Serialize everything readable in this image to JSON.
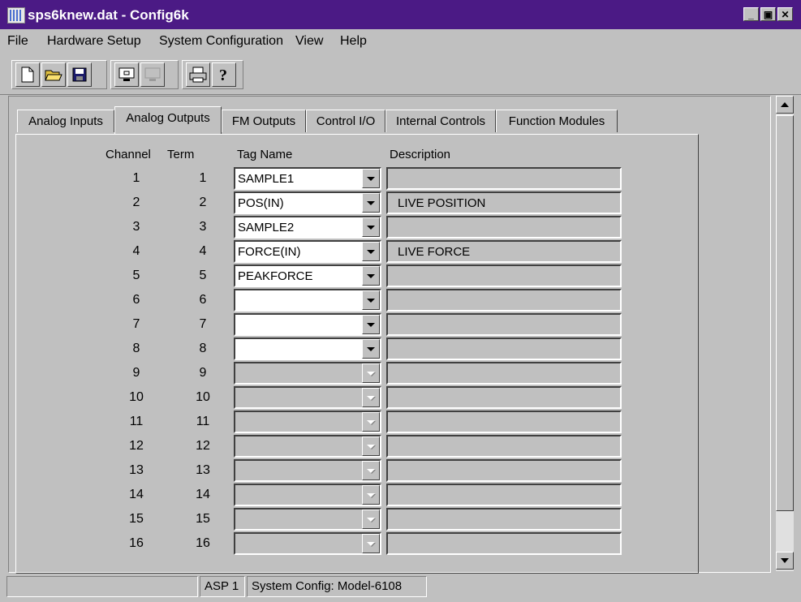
{
  "window": {
    "title": "sps6knew.dat - Config6k",
    "minimize": "_",
    "maximize": "▣",
    "close": "✕"
  },
  "menu": [
    "File",
    "Hardware Setup",
    "System Configuration",
    "View",
    "Help"
  ],
  "toolbar": {
    "icons": [
      "new-file-icon",
      "open-folder-icon",
      "save-disk-icon",
      "monitor-icon",
      "disabled-monitor-icon",
      "printer-icon",
      "help-icon"
    ]
  },
  "tabs": [
    "Analog Inputs",
    "Analog Outputs",
    "FM Outputs",
    "Control I/O",
    "Internal Controls",
    "Function Modules"
  ],
  "active_tab": "Analog Outputs",
  "headers": {
    "channel": "Channel",
    "term": "Term",
    "tag": "Tag Name",
    "desc": "Description"
  },
  "rows": [
    {
      "channel": "1",
      "term": "1",
      "tag": "SAMPLE1",
      "desc": "",
      "enabled": true
    },
    {
      "channel": "2",
      "term": "2",
      "tag": "POS(IN)",
      "desc": "LIVE POSITION",
      "enabled": true
    },
    {
      "channel": "3",
      "term": "3",
      "tag": "SAMPLE2",
      "desc": "",
      "enabled": true
    },
    {
      "channel": "4",
      "term": "4",
      "tag": "FORCE(IN)",
      "desc": "LIVE FORCE",
      "enabled": true
    },
    {
      "channel": "5",
      "term": "5",
      "tag": "PEAKFORCE",
      "desc": "",
      "enabled": true
    },
    {
      "channel": "6",
      "term": "6",
      "tag": "",
      "desc": "",
      "enabled": true
    },
    {
      "channel": "7",
      "term": "7",
      "tag": "",
      "desc": "",
      "enabled": true
    },
    {
      "channel": "8",
      "term": "8",
      "tag": "",
      "desc": "",
      "enabled": true
    },
    {
      "channel": "9",
      "term": "9",
      "tag": "",
      "desc": "",
      "enabled": false
    },
    {
      "channel": "10",
      "term": "10",
      "tag": "",
      "desc": "",
      "enabled": false
    },
    {
      "channel": "11",
      "term": "11",
      "tag": "",
      "desc": "",
      "enabled": false
    },
    {
      "channel": "12",
      "term": "12",
      "tag": "",
      "desc": "",
      "enabled": false
    },
    {
      "channel": "13",
      "term": "13",
      "tag": "",
      "desc": "",
      "enabled": false
    },
    {
      "channel": "14",
      "term": "14",
      "tag": "",
      "desc": "",
      "enabled": false
    },
    {
      "channel": "15",
      "term": "15",
      "tag": "",
      "desc": "",
      "enabled": false
    },
    {
      "channel": "16",
      "term": "16",
      "tag": "",
      "desc": "",
      "enabled": false
    }
  ],
  "status": {
    "pane1": "",
    "pane2": "ASP 1",
    "pane3": "System Config: Model-6108"
  }
}
